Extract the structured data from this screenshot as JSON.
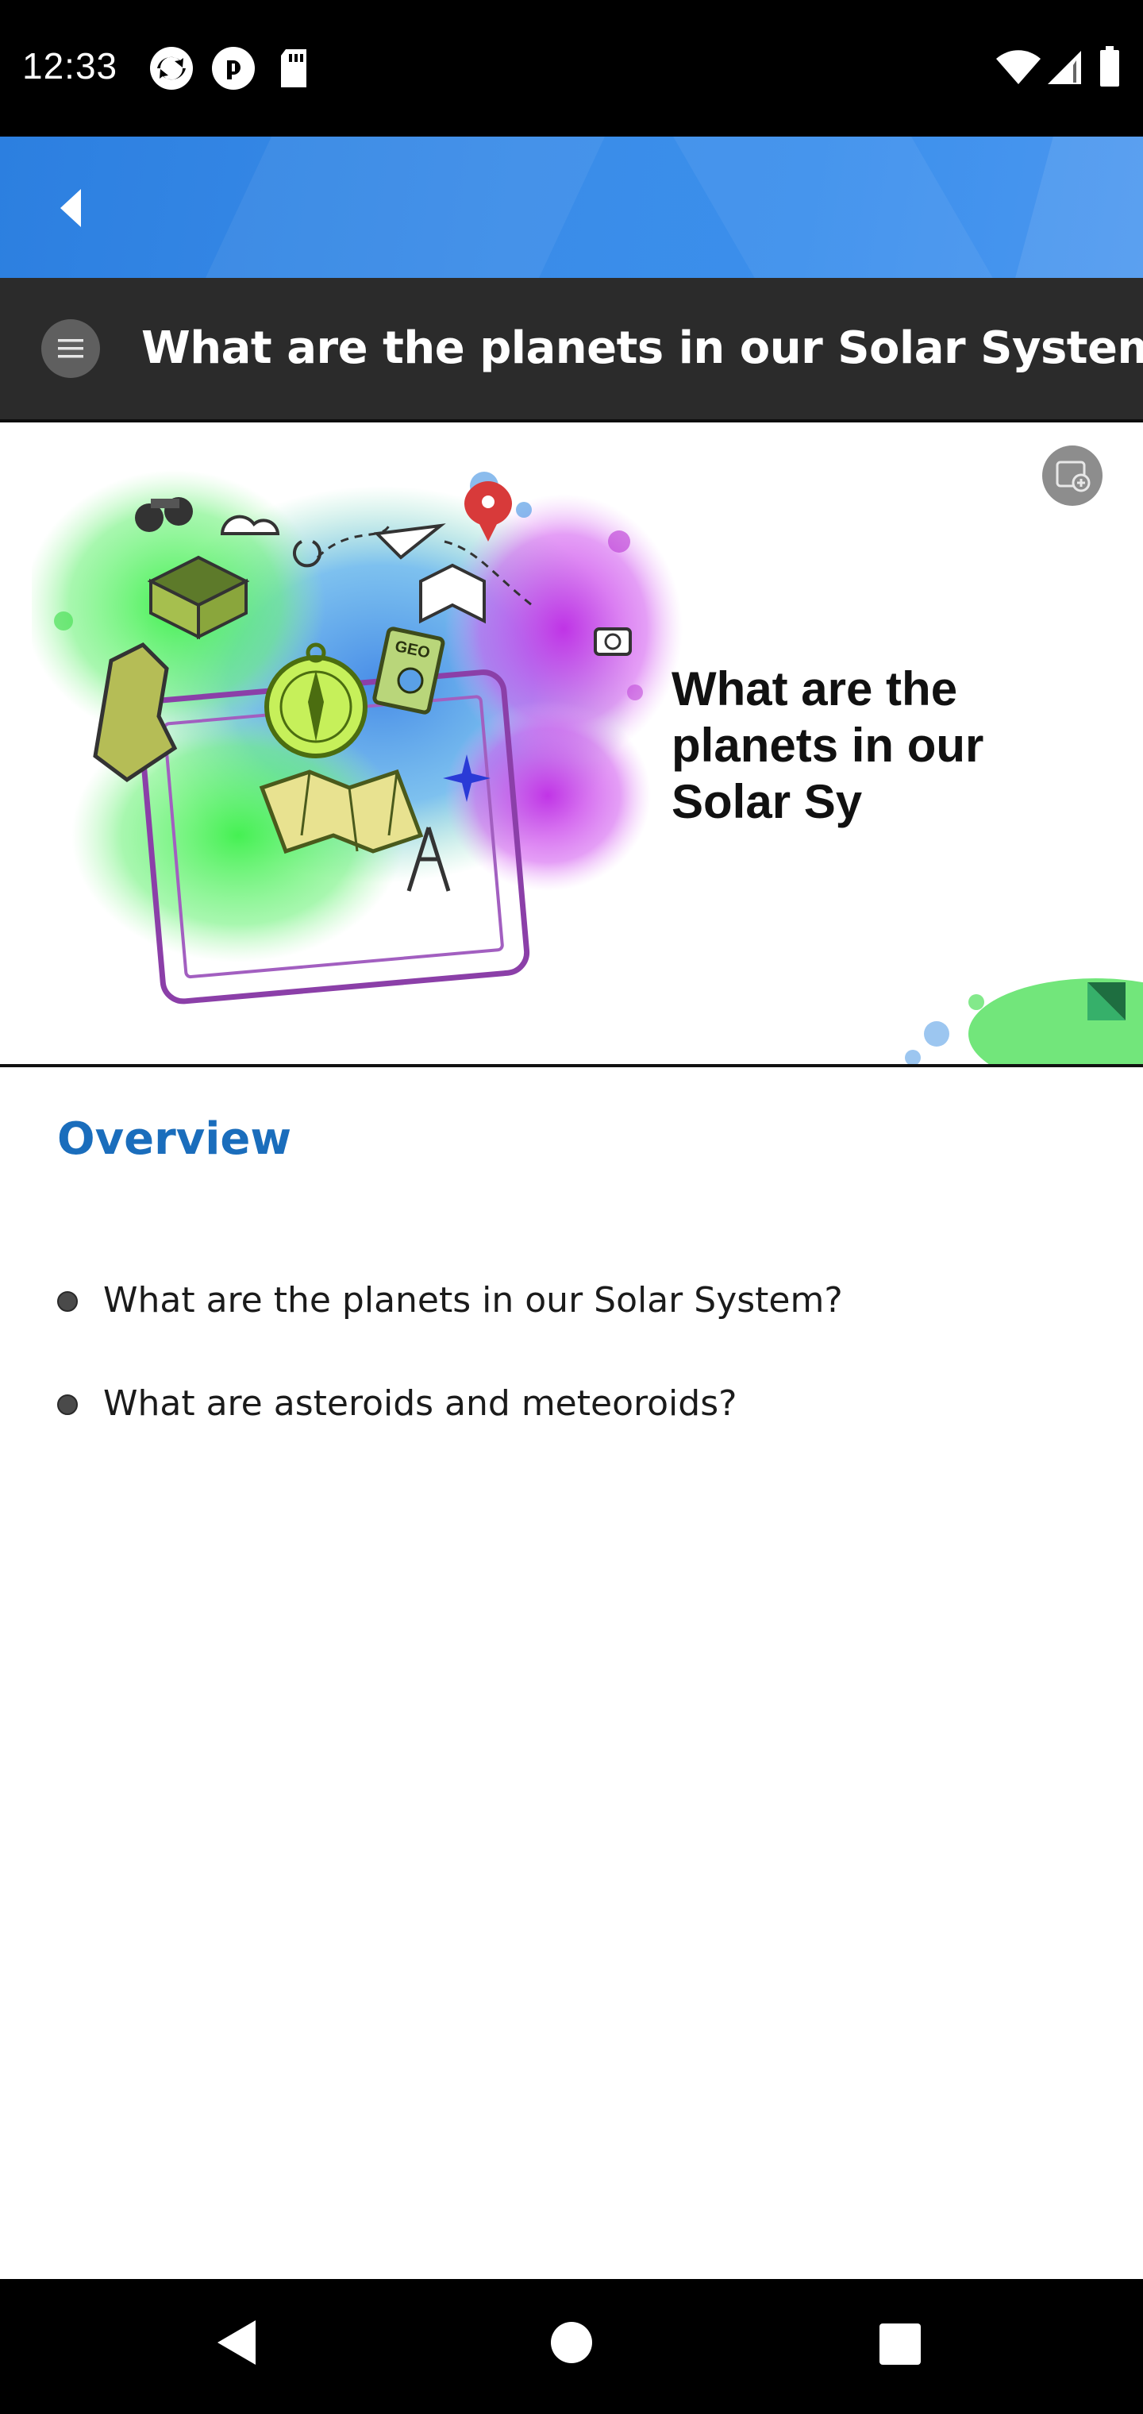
{
  "status_bar": {
    "time": "12:33",
    "left_icons": [
      "sync-icon",
      "pocket-casts-icon",
      "sd-card-icon"
    ],
    "right_icons": [
      "wifi-icon",
      "cell-signal-icon",
      "battery-icon"
    ]
  },
  "app_bar": {
    "back_icon": "back-arrow-icon",
    "accent_color": "#3a8ce8"
  },
  "lesson": {
    "menu_icon": "menu-icon",
    "title": "What are the planets in our Solar System?"
  },
  "banner": {
    "text": "What are the planets in our Solar Sy",
    "fullscreen_icon": "fullscreen-icon",
    "illustration": "geography-tablet-illustration"
  },
  "content": {
    "heading": "Overview",
    "heading_color": "#1a6dbc",
    "items": [
      "What are the planets in our Solar System?",
      "What are asteroids and meteoroids?"
    ]
  },
  "nav_bar": {
    "back": "nav-back-icon",
    "home": "nav-home-icon",
    "recents": "nav-recents-icon"
  }
}
